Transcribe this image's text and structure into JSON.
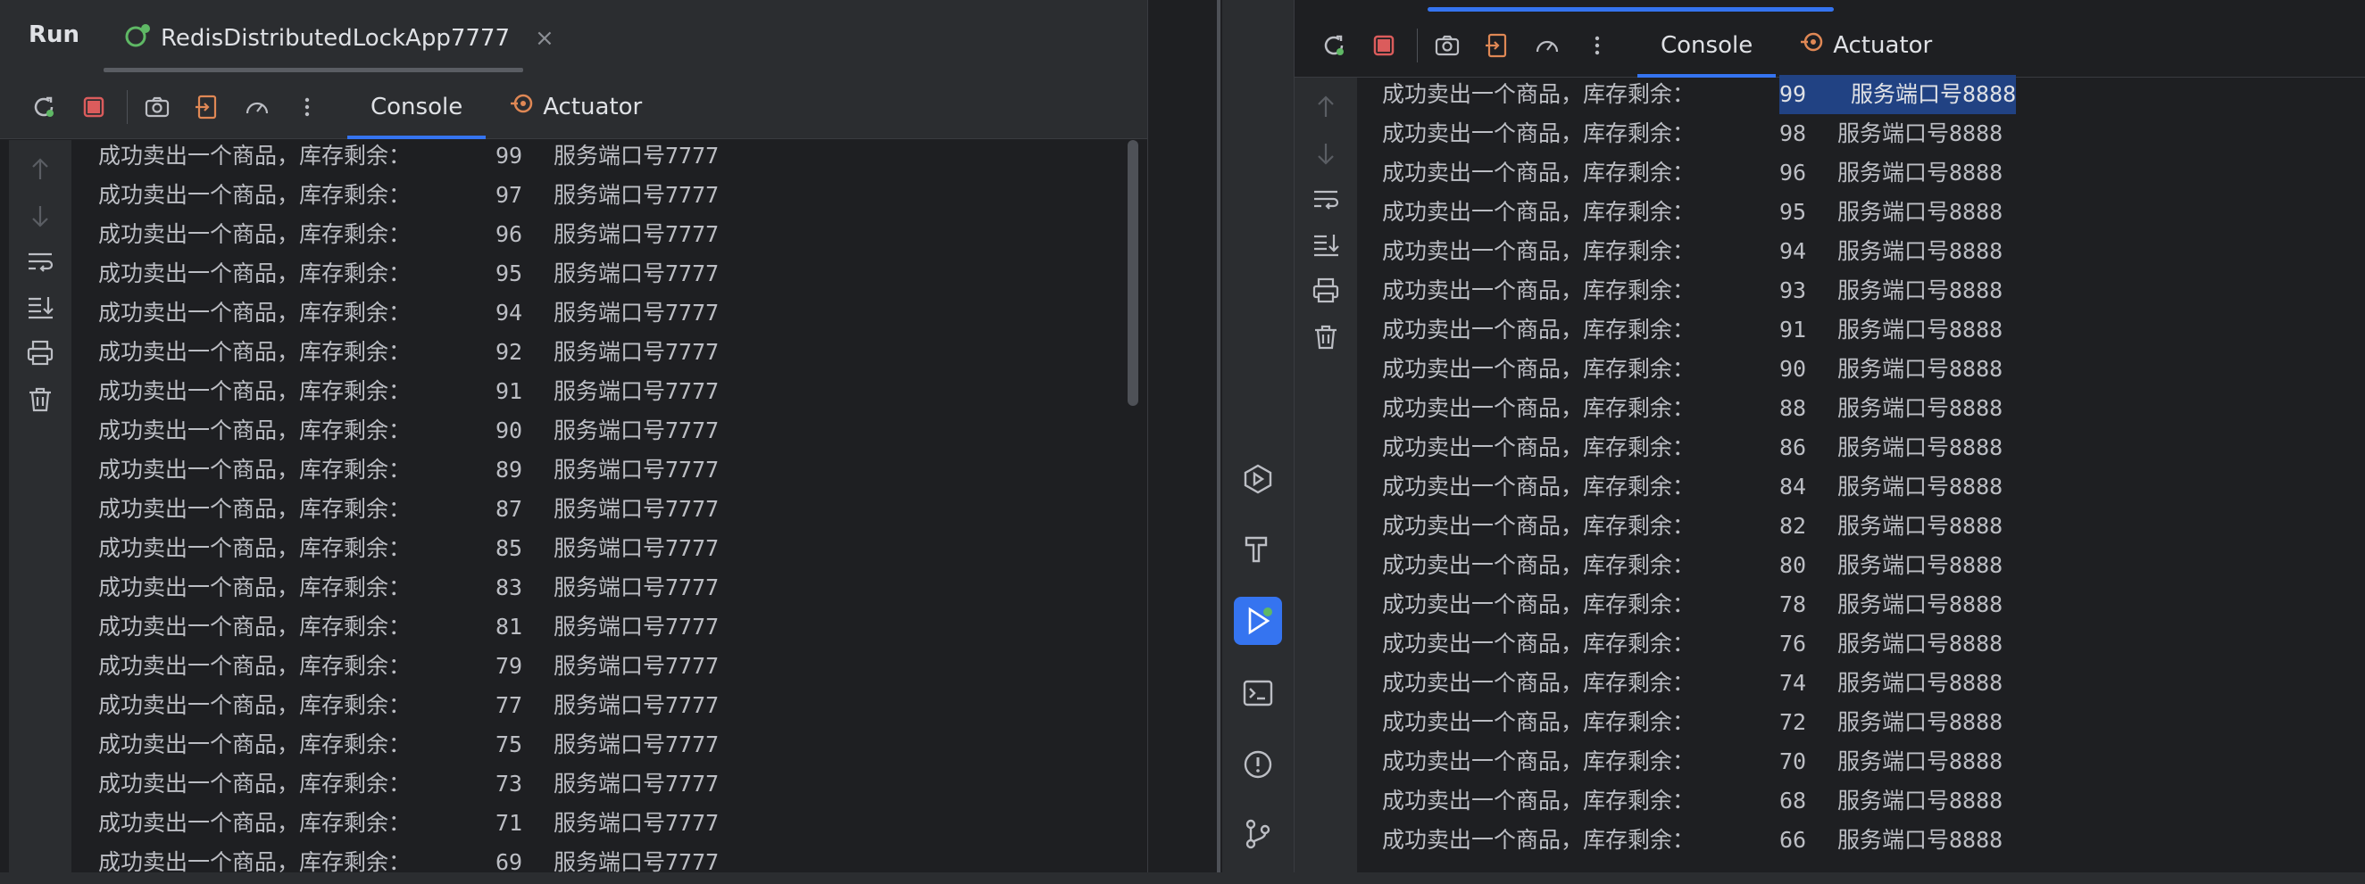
{
  "left": {
    "run_label": "Run",
    "tab_title": "RedisDistributedLockApp7777",
    "tab_close": "×",
    "toolbar": {
      "tabs": [
        {
          "label": "Console",
          "active": true
        },
        {
          "label": "Actuator",
          "active": false
        }
      ]
    },
    "console_lines": [
      {
        "prefix": "成功卖出一个商品，库存剩余：",
        "num": "99",
        "port": "服务端口号7777"
      },
      {
        "prefix": "成功卖出一个商品，库存剩余：",
        "num": "97",
        "port": "服务端口号7777"
      },
      {
        "prefix": "成功卖出一个商品，库存剩余：",
        "num": "96",
        "port": "服务端口号7777"
      },
      {
        "prefix": "成功卖出一个商品，库存剩余：",
        "num": "95",
        "port": "服务端口号7777"
      },
      {
        "prefix": "成功卖出一个商品，库存剩余：",
        "num": "94",
        "port": "服务端口号7777"
      },
      {
        "prefix": "成功卖出一个商品，库存剩余：",
        "num": "92",
        "port": "服务端口号7777"
      },
      {
        "prefix": "成功卖出一个商品，库存剩余：",
        "num": "91",
        "port": "服务端口号7777"
      },
      {
        "prefix": "成功卖出一个商品，库存剩余：",
        "num": "90",
        "port": "服务端口号7777"
      },
      {
        "prefix": "成功卖出一个商品，库存剩余：",
        "num": "89",
        "port": "服务端口号7777"
      },
      {
        "prefix": "成功卖出一个商品，库存剩余：",
        "num": "87",
        "port": "服务端口号7777"
      },
      {
        "prefix": "成功卖出一个商品，库存剩余：",
        "num": "85",
        "port": "服务端口号7777"
      },
      {
        "prefix": "成功卖出一个商品，库存剩余：",
        "num": "83",
        "port": "服务端口号7777"
      },
      {
        "prefix": "成功卖出一个商品，库存剩余：",
        "num": "81",
        "port": "服务端口号7777"
      },
      {
        "prefix": "成功卖出一个商品，库存剩余：",
        "num": "79",
        "port": "服务端口号7777"
      },
      {
        "prefix": "成功卖出一个商品，库存剩余：",
        "num": "77",
        "port": "服务端口号7777"
      },
      {
        "prefix": "成功卖出一个商品，库存剩余：",
        "num": "75",
        "port": "服务端口号7777"
      },
      {
        "prefix": "成功卖出一个商品，库存剩余：",
        "num": "73",
        "port": "服务端口号7777"
      },
      {
        "prefix": "成功卖出一个商品，库存剩余：",
        "num": "71",
        "port": "服务端口号7777"
      },
      {
        "prefix": "成功卖出一个商品，库存剩余：",
        "num": "69",
        "port": "服务端口号7777"
      }
    ]
  },
  "right": {
    "toolbar": {
      "tabs": [
        {
          "label": "Console",
          "active": true
        },
        {
          "label": "Actuator",
          "active": false
        }
      ]
    },
    "console_lines": [
      {
        "prefix": "成功卖出一个商品，库存剩余：",
        "num": "99",
        "port": "服务端口号8888",
        "selected": true
      },
      {
        "prefix": "成功卖出一个商品，库存剩余：",
        "num": "98",
        "port": "服务端口号8888"
      },
      {
        "prefix": "成功卖出一个商品，库存剩余：",
        "num": "96",
        "port": "服务端口号8888"
      },
      {
        "prefix": "成功卖出一个商品，库存剩余：",
        "num": "95",
        "port": "服务端口号8888"
      },
      {
        "prefix": "成功卖出一个商品，库存剩余：",
        "num": "94",
        "port": "服务端口号8888"
      },
      {
        "prefix": "成功卖出一个商品，库存剩余：",
        "num": "93",
        "port": "服务端口号8888"
      },
      {
        "prefix": "成功卖出一个商品，库存剩余：",
        "num": "91",
        "port": "服务端口号8888"
      },
      {
        "prefix": "成功卖出一个商品，库存剩余：",
        "num": "90",
        "port": "服务端口号8888"
      },
      {
        "prefix": "成功卖出一个商品，库存剩余：",
        "num": "88",
        "port": "服务端口号8888"
      },
      {
        "prefix": "成功卖出一个商品，库存剩余：",
        "num": "86",
        "port": "服务端口号8888"
      },
      {
        "prefix": "成功卖出一个商品，库存剩余：",
        "num": "84",
        "port": "服务端口号8888"
      },
      {
        "prefix": "成功卖出一个商品，库存剩余：",
        "num": "82",
        "port": "服务端口号8888"
      },
      {
        "prefix": "成功卖出一个商品，库存剩余：",
        "num": "80",
        "port": "服务端口号8888"
      },
      {
        "prefix": "成功卖出一个商品，库存剩余：",
        "num": "78",
        "port": "服务端口号8888"
      },
      {
        "prefix": "成功卖出一个商品，库存剩余：",
        "num": "76",
        "port": "服务端口号8888"
      },
      {
        "prefix": "成功卖出一个商品，库存剩余：",
        "num": "74",
        "port": "服务端口号8888"
      },
      {
        "prefix": "成功卖出一个商品，库存剩余：",
        "num": "72",
        "port": "服务端口号8888"
      },
      {
        "prefix": "成功卖出一个商品，库存剩余：",
        "num": "70",
        "port": "服务端口号8888"
      },
      {
        "prefix": "成功卖出一个商品，库存剩余：",
        "num": "68",
        "port": "服务端口号8888"
      },
      {
        "prefix": "成功卖出一个商品，库存剩余：",
        "num": "66",
        "port": "服务端口号8888"
      }
    ]
  },
  "icons": {
    "rerun": "rerun-icon",
    "stop": "stop-icon",
    "screenshot": "camera-icon",
    "exit": "exit-icon",
    "threads": "gauge-icon",
    "more": "more-vertical-icon",
    "scroll_up": "arrow-up-icon",
    "scroll_down": "arrow-down-icon",
    "soft_wrap": "soft-wrap-icon",
    "scroll_end": "scroll-to-end-icon",
    "print": "print-icon",
    "clear": "trash-icon",
    "services": "services-icon",
    "build": "hammer-icon",
    "run": "run-icon",
    "terminal": "terminal-icon",
    "problems": "problems-icon",
    "git": "git-icon"
  },
  "colors": {
    "accent": "#3574f0",
    "stop": "#db5c5c",
    "run_green": "#5fb865",
    "actuator": "#e08855",
    "selection": "#214283"
  }
}
